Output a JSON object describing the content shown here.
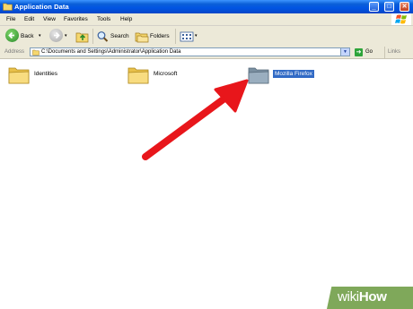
{
  "window": {
    "title": "Application Data",
    "minimize_glyph": "_",
    "maximize_glyph": "□",
    "close_glyph": "✕"
  },
  "menu": [
    "File",
    "Edit",
    "View",
    "Favorites",
    "Tools",
    "Help"
  ],
  "toolbar": {
    "back_label": "Back",
    "search_label": "Search",
    "folders_label": "Folders"
  },
  "address": {
    "label": "Address",
    "value": "C:\\Documents and Settings\\Administrator\\Application Data",
    "go_label": "Go",
    "links_label": "Links"
  },
  "folders": [
    {
      "name": "Identities",
      "selected": false
    },
    {
      "name": "Microsoft",
      "selected": false
    },
    {
      "name": "Mozilla Firefox",
      "selected": true
    }
  ],
  "watermark": {
    "prefix": "wiki",
    "suffix": "How"
  },
  "colors": {
    "titlebar": "#0054e3",
    "chrome": "#ece9d8",
    "selection": "#316ac5",
    "folder": "#f5d76e",
    "selected_folder": "#8fa3b5",
    "arrow": "#e8161b",
    "wikihow": "#7fa85a"
  },
  "icons": [
    "app-folder-icon",
    "back-arrow-icon",
    "forward-arrow-icon",
    "up-folder-icon",
    "search-icon",
    "folders-icon",
    "views-icon",
    "go-icon",
    "windows-logo-icon",
    "folder-icon",
    "red-arrow-annotation"
  ]
}
